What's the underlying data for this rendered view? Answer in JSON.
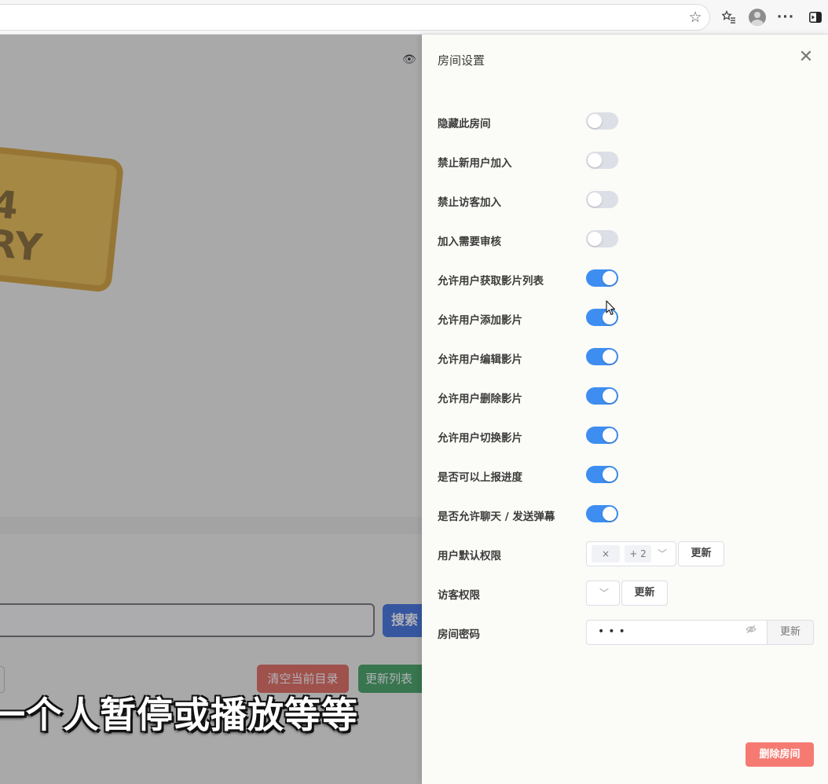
{
  "browser": {
    "icons": [
      "star-icon",
      "favorites-icon",
      "profile-avatar-icon",
      "more-icon",
      "sidebar-toggle-icon"
    ]
  },
  "background_page": {
    "logo_text": "4\nRY",
    "search_button": "搜索",
    "clear_button": "清空当前目录",
    "refresh_button": "更新列表",
    "subtitle": "一个人暂停或播放等等"
  },
  "drawer": {
    "title": "房间设置",
    "settings": [
      {
        "label": "隐藏此房间",
        "enabled": false
      },
      {
        "label": "禁止新用户加入",
        "enabled": false
      },
      {
        "label": "禁止访客加入",
        "enabled": false
      },
      {
        "label": "加入需要审核",
        "enabled": false
      },
      {
        "label": "允许用户获取影片列表",
        "enabled": true
      },
      {
        "label": "允许用户添加影片",
        "enabled": true
      },
      {
        "label": "允许用户编辑影片",
        "enabled": true
      },
      {
        "label": "允许用户删除影片",
        "enabled": true
      },
      {
        "label": "允许用户切换影片",
        "enabled": true
      },
      {
        "label": "是否可以上报进度",
        "enabled": true
      },
      {
        "label": "是否允许聊天 / 发送弹幕",
        "enabled": true
      }
    ],
    "user_permission": {
      "label": "用户默认权限",
      "tag_close": "×",
      "tag_more": "+ 2",
      "update_button": "更新"
    },
    "guest_permission": {
      "label": "访客权限",
      "update_button": "更新"
    },
    "room_password": {
      "label": "房间密码",
      "value": "•••",
      "update_button": "更新"
    },
    "delete_button": "删除房间",
    "colors": {
      "switch_on": "#3d8ef0",
      "switch_off": "#dcdfe6",
      "danger": "#f57b72"
    }
  }
}
